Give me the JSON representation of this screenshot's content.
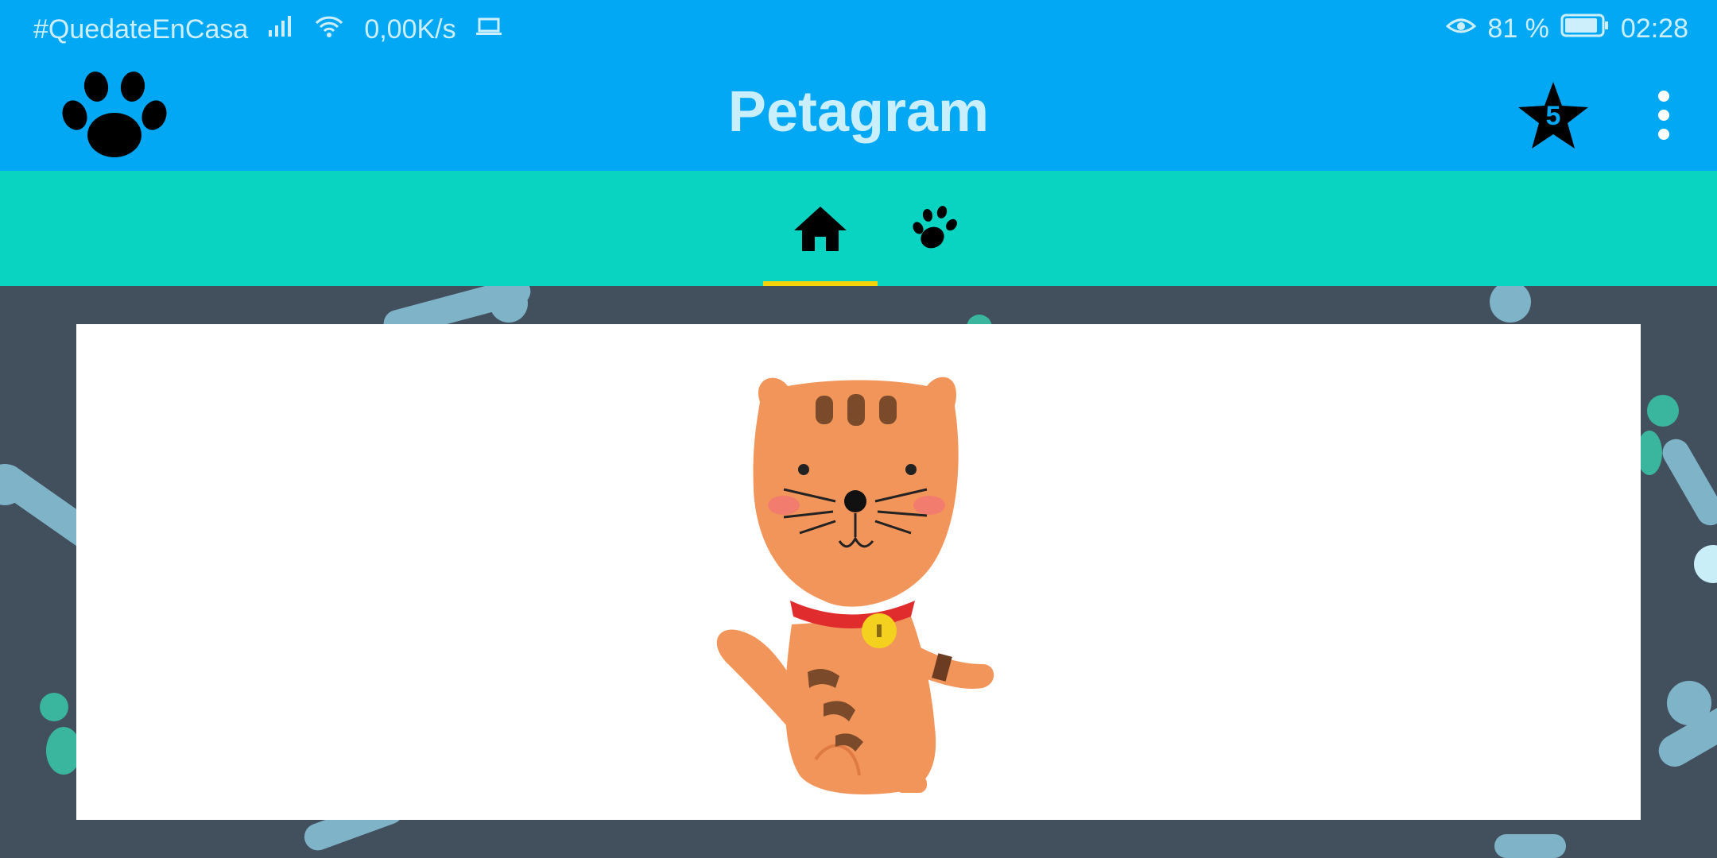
{
  "status_bar": {
    "hashtag": "#QuedateEnCasa",
    "network_speed": "0,00K/s",
    "battery_percent": "81 %",
    "time": "02:28",
    "icons": [
      "signal-icon",
      "wifi-icon",
      "laptop-icon",
      "eye-icon",
      "battery-icon"
    ]
  },
  "app_bar": {
    "title": "Petagram",
    "logo_icon": "paw-icon",
    "favorites_count": "5",
    "menu_icon": "more-vert-icon"
  },
  "tabs": [
    {
      "name": "home",
      "icon": "home-icon",
      "selected": true
    },
    {
      "name": "profile",
      "icon": "paw-icon",
      "selected": false
    }
  ],
  "colors": {
    "app_bar": "#03a8f4",
    "tab_bar": "#09d4c2",
    "tab_indicator": "#f5d50a",
    "background": "#42505e",
    "title_text": "#c9eefc"
  },
  "content": {
    "pet_image": "cat-illustration"
  }
}
